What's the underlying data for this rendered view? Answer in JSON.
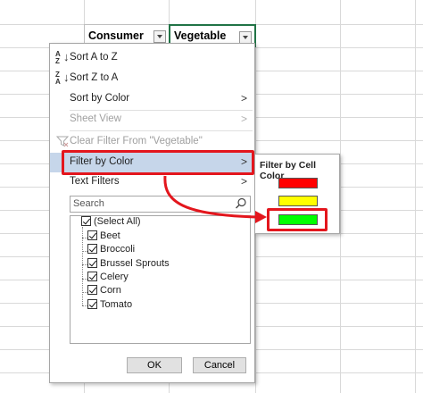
{
  "sheet": {
    "headers": [
      {
        "label": "Consumer"
      },
      {
        "label": "Vegetable"
      }
    ]
  },
  "menu": {
    "sort_az": "Sort A to Z",
    "sort_za": "Sort Z to A",
    "sort_by_color": "Sort by Color",
    "sheet_view": "Sheet View",
    "clear_filter": "Clear Filter From \"Vegetable\"",
    "filter_by_color": "Filter by Color",
    "text_filters": "Text Filters",
    "chevron": ">",
    "search_placeholder": "Search",
    "items": [
      {
        "label": "(Select All)"
      },
      {
        "label": "Beet"
      },
      {
        "label": "Broccoli"
      },
      {
        "label": "Brussel Sprouts"
      },
      {
        "label": "Celery"
      },
      {
        "label": "Corn"
      },
      {
        "label": "Tomato"
      }
    ],
    "ok": "OK",
    "cancel": "Cancel"
  },
  "submenu": {
    "title": "Filter by Cell Color",
    "colors": [
      "#ff0000",
      "#ffff00",
      "#00ff00"
    ]
  },
  "annotation_color": "#e3161d"
}
